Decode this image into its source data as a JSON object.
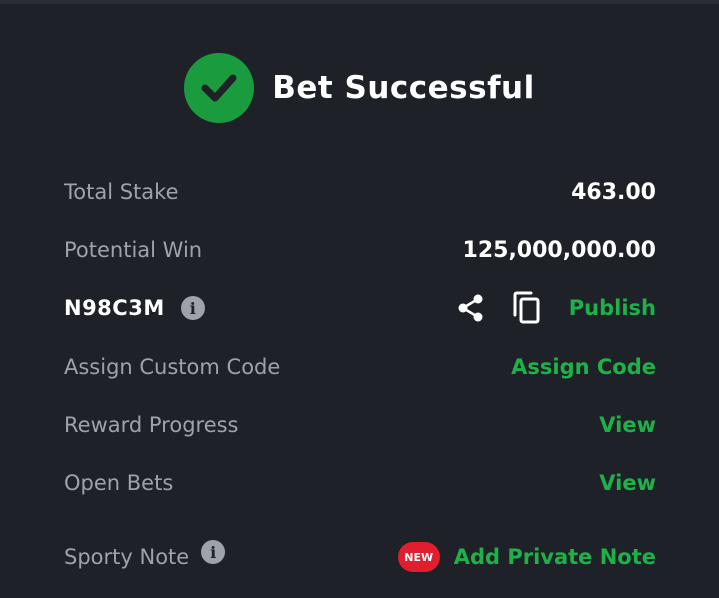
{
  "header": {
    "title": "Bet Successful",
    "icon": "check-circle-icon"
  },
  "summary": {
    "total_stake_label": "Total Stake",
    "total_stake_value": "463.00",
    "potential_win_label": "Potential Win",
    "potential_win_value": "125,000,000.00"
  },
  "booking": {
    "code": "N98C3M",
    "info_icon": "info-icon",
    "share_icon": "share-icon",
    "copy_icon": "copy-icon",
    "publish_label": "Publish"
  },
  "custom_code": {
    "label": "Assign Custom Code",
    "action": "Assign Code"
  },
  "reward_progress": {
    "label": "Reward Progress",
    "action": "View"
  },
  "open_bets": {
    "label": "Open Bets",
    "action": "View"
  },
  "sporty_note": {
    "label": "Sporty Note",
    "badge": "NEW",
    "action": "Add Private Note"
  },
  "colors": {
    "background": "#1e2127",
    "accent": "#1eb14a",
    "check": "#1a9c3e",
    "badge": "#e01e2d",
    "muted": "#9ea3ab"
  }
}
